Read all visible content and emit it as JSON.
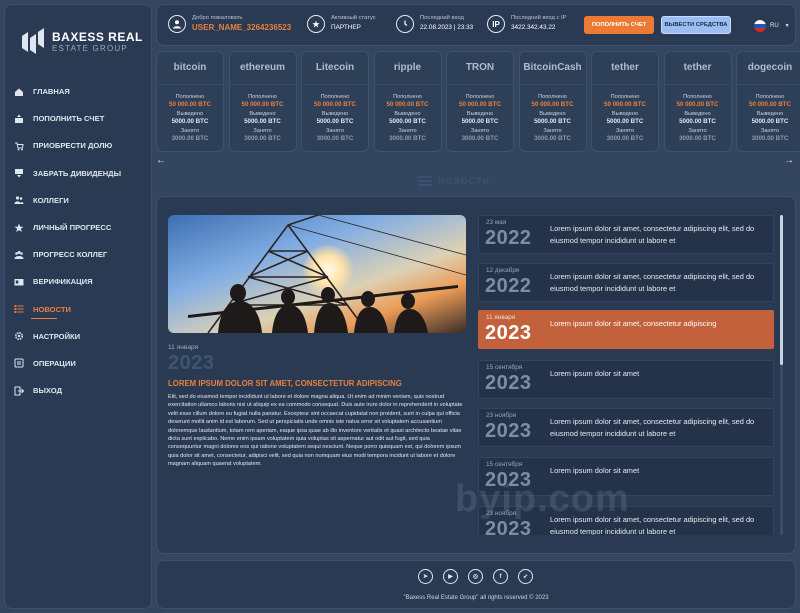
{
  "brand": {
    "name": "BAXESS REAL",
    "sub": "ESTATE GROUP"
  },
  "nav": [
    {
      "label": "ГЛАВНАЯ",
      "icon": "home-icon"
    },
    {
      "label": "ПОПОЛНИТЬ СЧЕТ",
      "icon": "deposit-icon"
    },
    {
      "label": "ПРИОБРЕСТИ ДОЛЮ",
      "icon": "cart-icon"
    },
    {
      "label": "ЗАБРАТЬ ДИВИДЕНДЫ",
      "icon": "withdraw-icon"
    },
    {
      "label": "КОЛЛЕГИ",
      "icon": "users-icon"
    },
    {
      "label": "ЛИЧНЫЙ ПРОГРЕСС",
      "icon": "star-icon"
    },
    {
      "label": "ПРОГРЕСС КОЛЛЕГ",
      "icon": "team-icon"
    },
    {
      "label": "ВЕРИФИКАЦИЯ",
      "icon": "id-card-icon"
    },
    {
      "label": "НОВОСТИ",
      "icon": "news-icon",
      "active": true
    },
    {
      "label": "НАСТРОЙКИ",
      "icon": "gear-icon"
    },
    {
      "label": "ОПЕРАЦИИ",
      "icon": "operations-icon"
    },
    {
      "label": "ВЫХОД",
      "icon": "logout-icon"
    }
  ],
  "topbar": {
    "welcome_label": "Добро пожаловать",
    "username": "USER_NAME_3264236523",
    "status_label": "Активный статус",
    "status_value": "ПАРТНЕР",
    "last_login_label": "Последний вход",
    "last_login_value": "22.08.2023 | 23:33",
    "last_ip_label": "Последний вход с IP",
    "last_ip_value": "3422.342.43.22",
    "ip_icon_text": "IP",
    "deposit_button": "ПОПОЛНИТЬ СЧЕТ",
    "withdraw_button": "ВЫВЕСТИ СРЕДСТВА",
    "language": "RU"
  },
  "coin_labels": {
    "deposited": "Пополнено",
    "withdrawn": "Выведено",
    "borrowed": "Занято"
  },
  "coins": [
    {
      "name": "bitcoin",
      "deposited": "50 000.00 BTC",
      "withdrawn": "5000.00 BTC",
      "borrowed": "3000.00 BTC"
    },
    {
      "name": "ethereum",
      "deposited": "50 000.00 BTC",
      "withdrawn": "5000.00 BTC",
      "borrowed": "3000.00 BTC"
    },
    {
      "name": "Litecoin",
      "deposited": "50 000.00 BTC",
      "withdrawn": "5000.00 BTC",
      "borrowed": "3000.00 BTC"
    },
    {
      "name": "ripple",
      "deposited": "50 000.00 BTC",
      "withdrawn": "5000.00 BTC",
      "borrowed": "3000.00 BTC"
    },
    {
      "name": "TRON",
      "deposited": "50 000.00 BTC",
      "withdrawn": "5000.00 BTC",
      "borrowed": "3000.00 BTC"
    },
    {
      "name": "BitcoinCash",
      "deposited": "50 000.00 BTC",
      "withdrawn": "5000.00 BTC",
      "borrowed": "3000.00 BTC"
    },
    {
      "name": "tether",
      "deposited": "50 000.00 BTC",
      "withdrawn": "5000.00 BTC",
      "borrowed": "3000.00 BTC"
    },
    {
      "name": "tether",
      "deposited": "50 000.00 BTC",
      "withdrawn": "5000.00 BTC",
      "borrowed": "3000.00 BTC"
    },
    {
      "name": "dogecoin",
      "deposited": "50 000.00 BTC",
      "withdrawn": "5000.00 BTC",
      "borrowed": "3000.00 BTC"
    }
  ],
  "section_title": "НОВОСТИ",
  "article": {
    "day": "11 января",
    "year": "2023",
    "headline": "LOREM IPSUM DOLOR SIT AMET, CONSECTETUR ADIPISCING",
    "body": "Elit, sed do eiusmod tempor incididunt ut labore et dolore magna aliqua. Ut enim ad minim veniam, quis nostrud exercitation ullamco laboris nisi ut aliquip ex ea commodo consequat. Duis aute irure dolor in reprehenderit in voluptate velit esse cillum dolore eu fugiat nulla pariatur. Excepteur sint occaecat cupidatat non proident, sunt in culpa qui officia deserunt mollit anim id est laborum. Sed ut perspiciatis unde omnis iste natus error sit voluptatem accusantium doloremque laudantium, totam rem aperiam, eaque ipsa quae ab illo inventore veritatis et quasi architecto beatae vitae dicta sunt explicabo. Nemo enim ipsam voluptatem quia voluptas sit aspernatur aut odit aut fugit, sed quia consequuntur magni dolores eos qui ratione voluptatem sequi nesciunt. Neque porro quisquam est, qui dolorem ipsum quia dolor sit amet, consectetur, adipisci velit, sed quia non numquam eius modi tempora incidunt ut labore et dolore magnam aliquam quaerat voluptatem."
  },
  "news": [
    {
      "day": "23 мая",
      "year": "2022",
      "title": "Lorem ipsum dolor sit amet, consectetur adipiscing elit, sed do eiusmod tempor incididunt ut labore et"
    },
    {
      "day": "12 декабря",
      "year": "2022",
      "title": "Lorem ipsum dolor sit amet, consectetur adipiscing elit, sed do eiusmod tempor incididunt ut labore et"
    },
    {
      "day": "11 января",
      "year": "2023",
      "title": "Lorem ipsum dolor sit amet, consectetur adipiscing",
      "selected": true
    },
    {
      "day": "15 сентября",
      "year": "2023",
      "title": "Lorem ipsum dolor sit amet"
    },
    {
      "day": "23 ноября",
      "year": "2023",
      "title": "Lorem ipsum dolor sit amet, consectetur adipiscing elit, sed do eiusmod tempor incididunt ut labore et"
    },
    {
      "day": "15 сентября",
      "year": "2023",
      "title": "Lorem ipsum dolor sit amet"
    },
    {
      "day": "23 ноября",
      "year": "2023",
      "title": "Lorem ipsum dolor sit amet, consectetur adipiscing elit, sed do eiusmod tempor incididunt ut labore et"
    }
  ],
  "watermark": "byip.com",
  "footer": {
    "copyright": "\"Baxess Real Estate Group\" all rights reserved © 2023",
    "socials": [
      "telegram-icon",
      "youtube-icon",
      "instagram-icon",
      "facebook-icon",
      "telegram-channel-icon"
    ]
  }
}
